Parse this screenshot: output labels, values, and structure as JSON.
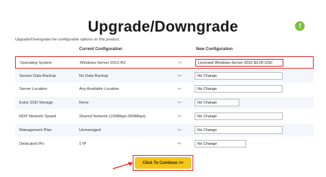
{
  "page": {
    "title": "Upgrade/Downgrade",
    "description": "Upgrade/Downgrade the configurable options on this product."
  },
  "icons": {
    "info": "info-circle-icon",
    "arrow": "arrow-right-icon"
  },
  "colors": {
    "accent_green": "#7ac142",
    "highlight_red": "#e02020",
    "button_yellow": "#f5c518"
  },
  "table": {
    "headers": {
      "current": "Current Configuration",
      "new": "New Configuration"
    },
    "arrow_text": "=>",
    "rows": [
      {
        "label": "Operating System",
        "current": "Windows-Server-2012-R2",
        "new": "Licensed Windows-Server-2016 $3.00 USD"
      },
      {
        "label": "Secure Data Backup",
        "current": "No Data Backup",
        "new": "No Change"
      },
      {
        "label": "Server Location",
        "current": "Any Available Location",
        "new": "No Change"
      },
      {
        "label": "Extra SSD Storage",
        "current": "None",
        "new": "No Change"
      },
      {
        "label": "RDP Network Speed",
        "current": "Shared Network (100Mbps-300Mbps)",
        "new": "No Change"
      },
      {
        "label": "Management Plan",
        "current": "Unmanaged",
        "new": "No Change"
      },
      {
        "label": "Dedicated IPs",
        "current": "1 IP",
        "new": "No Change"
      }
    ]
  },
  "actions": {
    "continue_label": "Click To Continue >>"
  }
}
